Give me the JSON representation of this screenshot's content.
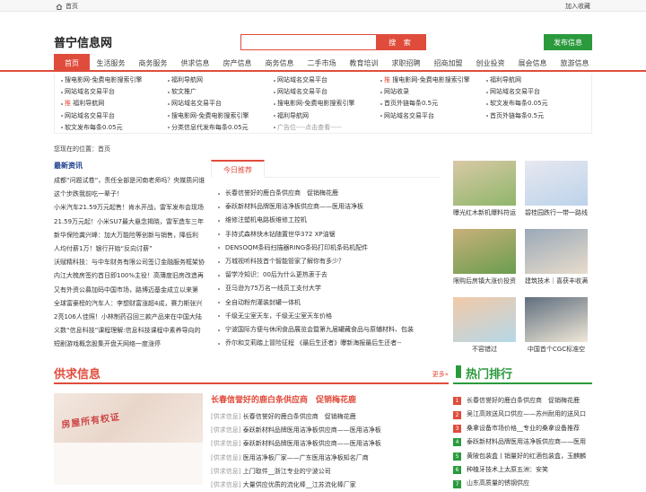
{
  "topbar": {
    "home": "首页",
    "favorite": "加入收藏"
  },
  "header": {
    "logo": "普宁信息网",
    "search_placeholder": "",
    "search_button": "搜 索",
    "publish_button": "发布信息"
  },
  "nav": [
    "首页",
    "生活服务",
    "商务服务",
    "供求信息",
    "房产信息",
    "商务信息",
    "二手市场",
    "教育培训",
    "求职招聘",
    "招商加盟",
    "创业投资",
    "展会信息",
    "旅游信息"
  ],
  "links": {
    "col1": [
      "搜电影网-免费电影搜索引擎",
      "网站域名交易平台",
      "福利导航网",
      "网站域名交易平台",
      "软文发布每条0.05元"
    ],
    "col2": [
      "福利导航网",
      "软文推广",
      "网站域名交易平台",
      "搜电影网-免费电影搜索引擎",
      "分类信息代发布每条0.05元"
    ],
    "col3": [
      "网站域名交易平台",
      "网站域名交易平台",
      "搜电影网-免费电影搜索引擎",
      "福利导航网",
      "广告位----点击查看-----"
    ],
    "col4": [
      "推 搜电影网-免费电影搜索引擎",
      "网站收录",
      "首页外链每条0.5元",
      "网站域名交易平台"
    ],
    "col4_tag": "推",
    "col4_0": "搜电影网-免费电影搜索引擎",
    "col3_ad": "广告位----点击查看-----",
    "col1_tag": "推",
    "col1_2": "福利导航网",
    "col5": [
      "福利导航网",
      "网站域名交易平台",
      "软文发布每条0.05元",
      "首页外链每条0.5元"
    ]
  },
  "breadcrumb": "您现在的位置：首页",
  "latest": {
    "title": "最新资讯",
    "lines": [
      "成都“问题试卷”，责任全部是河南老师吗？央媒质问谁",
      "这个步跌我前吃一辈子！",
      "小米汽车21.59万元起售！肯水开战，雷军发布会现场",
      "21.59万元起！小米SU7最大悬念揭晓，雷军造车三年",
      "新华保险龚兴峰：加大万能险等创新与销售，降低利",
      "人均付薪1万！银行开始“反向讨薪”",
      "沃赋精科技：与中车财务有限公司签订金融服务框架协",
      "内江大梳房签约首日即100%主役！高薄度旧房改造再",
      "又有外资公募加码中国市场，路博迈基金成立以来第",
      "全球富豪榜的汽车人：李想财富涨超4成，赛力斯张兴",
      "2亮106人佳照！小林制药召回三款产品来在中国大陆",
      "义数“信息科技”课程理解:信息科技课程中素养导向的",
      "短剧游戏概念股集开盘天网络一度涨停"
    ]
  },
  "recommend": {
    "tab": "今日推荐",
    "items": [
      "长春信誉好的鹿白条供应商　促销梅花鹿",
      "泰跃新材料品牌医用洁净板供应商——医用洁净板",
      "维修注塑机电路板维修工控机",
      "手持式森林快木钻随置世华372 XP油锯",
      "DENSOQM条码扫描器RING条码打印机条码机配件",
      "万城视听科技首个智能管家了解你有多少？",
      "留学冷知识：00后为什么更热衷于去",
      "亚马逊为75万名一线员工支付大学",
      "全自动粉剂灌装封罐一体机",
      "千级无尘室天车，千级无尘室天车价格",
      "宁波国际方便与休闲食品展览会暨第九届罐藏食品与原辅材料、包装",
      "乔尔和艾莉踏上冒险征程 《最后生还者》曝新海报最后生还者--"
    ]
  },
  "photos": [
    {
      "caption": "曝光红木新机爆料符运",
      "color1": "#8fb66a",
      "color2": "#d9c9a6"
    },
    {
      "caption": "碧桂园跌行一带一路线",
      "color1": "#bcd3ea",
      "color2": "#e8e8f0"
    },
    {
      "caption": "限购后房镇大涨价投资",
      "color1": "#6a9d4f",
      "color2": "#c8b07a"
    },
    {
      "caption": "建筑技术｜喜获丰收满",
      "color1": "#e8dccc",
      "color2": "#9aa9b8"
    },
    {
      "caption": "不容错过",
      "color1": "#b6d8e8",
      "color2": "#f2c9a8"
    },
    {
      "caption": "中国首个CGC标准空",
      "color1": "#f0e8d8",
      "color2": "#5f6e7e"
    }
  ],
  "supply": {
    "title": "供求信息",
    "more": "更多»",
    "headline": "长春信誉好的鹿白条供应商　促销梅花鹿",
    "image_text": "房屋所有权证",
    "items": [
      {
        "cat": "[供求信息]",
        "text": "长春信誉好的鹿白条供应商　促销梅花鹿"
      },
      {
        "cat": "[供求信息]",
        "text": "泰跃新材料品牌医用洁净板供应商——医用洁净板"
      },
      {
        "cat": "[供求信息]",
        "text": "泰跃新材料品牌医用洁净板供应商——医用洁净板"
      },
      {
        "cat": "[供求信息]",
        "text": "医用洁净板厂家——广东医用洁净板知名厂商"
      },
      {
        "cat": "[供求信息]",
        "text": "上门取件__浙江专业的宁波公司"
      },
      {
        "cat": "[供求信息]",
        "text": "大量供应优质的流化棒__江苏流化棒厂家"
      }
    ]
  },
  "hot": {
    "title": "热门排行",
    "colors": [
      "#e04c3c",
      "#e04c3c",
      "#e04c3c",
      "#2a9a3d",
      "#2a9a3d",
      "#2a9a3d",
      "#2a9a3d"
    ],
    "items": [
      {
        "n": "1",
        "text": "长春信誉好的鹿白条供应商　促销梅花鹿"
      },
      {
        "n": "2",
        "text": "吴江高效送风口供应——苏州耐用的送风口"
      },
      {
        "n": "3",
        "text": "桑拿设备市场价格__专业的桑拿设备推荐"
      },
      {
        "n": "4",
        "text": "泰跃新材料品牌医用洁净板供应商——医用"
      },
      {
        "n": "5",
        "text": "黄陂包装盒丨销量好的红酒包装盒，玉麒麟"
      },
      {
        "n": "6",
        "text": "种植牙技术上太原五洲：安笑"
      },
      {
        "n": "7",
        "text": "山东高质量的锈钢供应"
      }
    ]
  }
}
